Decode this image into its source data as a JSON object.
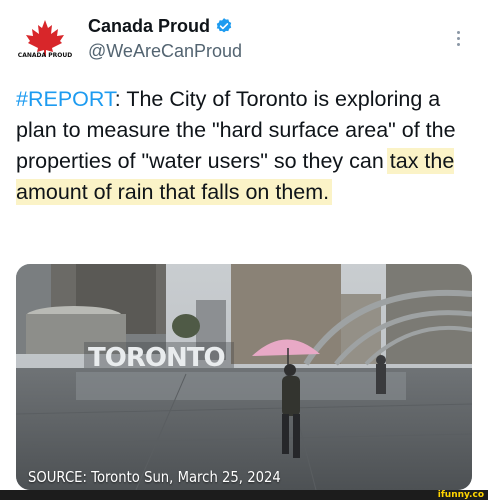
{
  "author": {
    "display_name": "Canada Proud",
    "handle": "@WeAreCanProud",
    "avatar_text": "CANADA PROUD"
  },
  "tweet": {
    "hashtag": "#REPORT",
    "body_part1": ": The City of Toronto is exploring a plan to measure the \"hard surface area\" of the properties of \"water users\" so they can ",
    "highlighted": "tax the amount of rain that falls on them."
  },
  "media": {
    "sign_text": "TORONTO",
    "source_caption": "SOURCE: Toronto Sun, March 25, 2024"
  },
  "watermark": "ifunny.co",
  "colors": {
    "accent": "#1d9bf0",
    "highlight": "#fbf3c7",
    "muted": "#536471"
  },
  "icons": [
    "maple-leaf-icon",
    "verified-badge-icon",
    "more-options-icon"
  ]
}
